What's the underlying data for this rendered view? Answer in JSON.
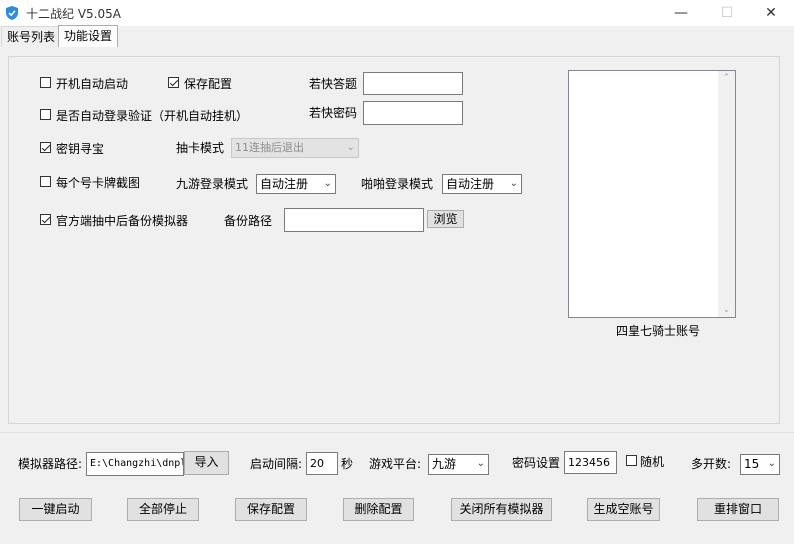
{
  "window": {
    "title": "十二战纪  V5.05A",
    "minimize": "—",
    "maximize": "☐",
    "close": "✕"
  },
  "tabs": [
    {
      "label": "账号列表",
      "active": false
    },
    {
      "label": "功能设置",
      "active": true
    }
  ],
  "settings": {
    "autostart_label": "开机自动启动",
    "autostart_checked": false,
    "save_config_label": "保存配置",
    "save_config_checked": true,
    "ruokuai_answer_label": "若快答题",
    "ruokuai_answer_value": "",
    "auto_login_label": "是否自动登录验证（开机自动挂机）",
    "auto_login_checked": false,
    "ruokuai_password_label": "若快密码",
    "ruokuai_password_value": "",
    "key_treasure_label": "密钥寻宝",
    "key_treasure_checked": true,
    "draw_mode_label": "抽卡模式",
    "draw_mode_value": "11连抽后退出",
    "screenshot_label": "每个号卡牌截图",
    "screenshot_checked": false,
    "jiuyou_login_label": "九游登录模式",
    "jiuyou_login_value": "自动注册",
    "papa_login_label": "啪啪登录模式",
    "papa_login_value": "自动注册",
    "official_backup_label": "官方端抽中后备份模拟器",
    "official_backup_checked": true,
    "backup_path_label": "备份路径",
    "backup_path_value": "",
    "browse_label": "浏览",
    "knights_caption": "四皇七骑士账号"
  },
  "bottom": {
    "emu_path_label": "模拟器路径:",
    "emu_path_value": "E:\\Changzhi\\dnpl",
    "import_label": "导入",
    "interval_label": "启动间隔:",
    "interval_value": "20",
    "seconds_label": "秒",
    "platform_label": "游戏平台:",
    "platform_value": "九游",
    "password_label": "密码设置",
    "password_value": "123456",
    "random_label": "随机",
    "random_checked": false,
    "multi_label": "多开数:",
    "multi_value": "15"
  },
  "actions": {
    "start_all": "一键启动",
    "stop_all": "全部停止",
    "save_config": "保存配置",
    "delete_config": "删除配置",
    "close_all_emus": "关闭所有模拟器",
    "gen_empty": "生成空账号",
    "rearrange": "重排窗口"
  },
  "colors": {
    "window_bg": "#f0f0f0",
    "titlebar_bg": "#ffffff",
    "icon_accent": "#2a8ce0"
  }
}
